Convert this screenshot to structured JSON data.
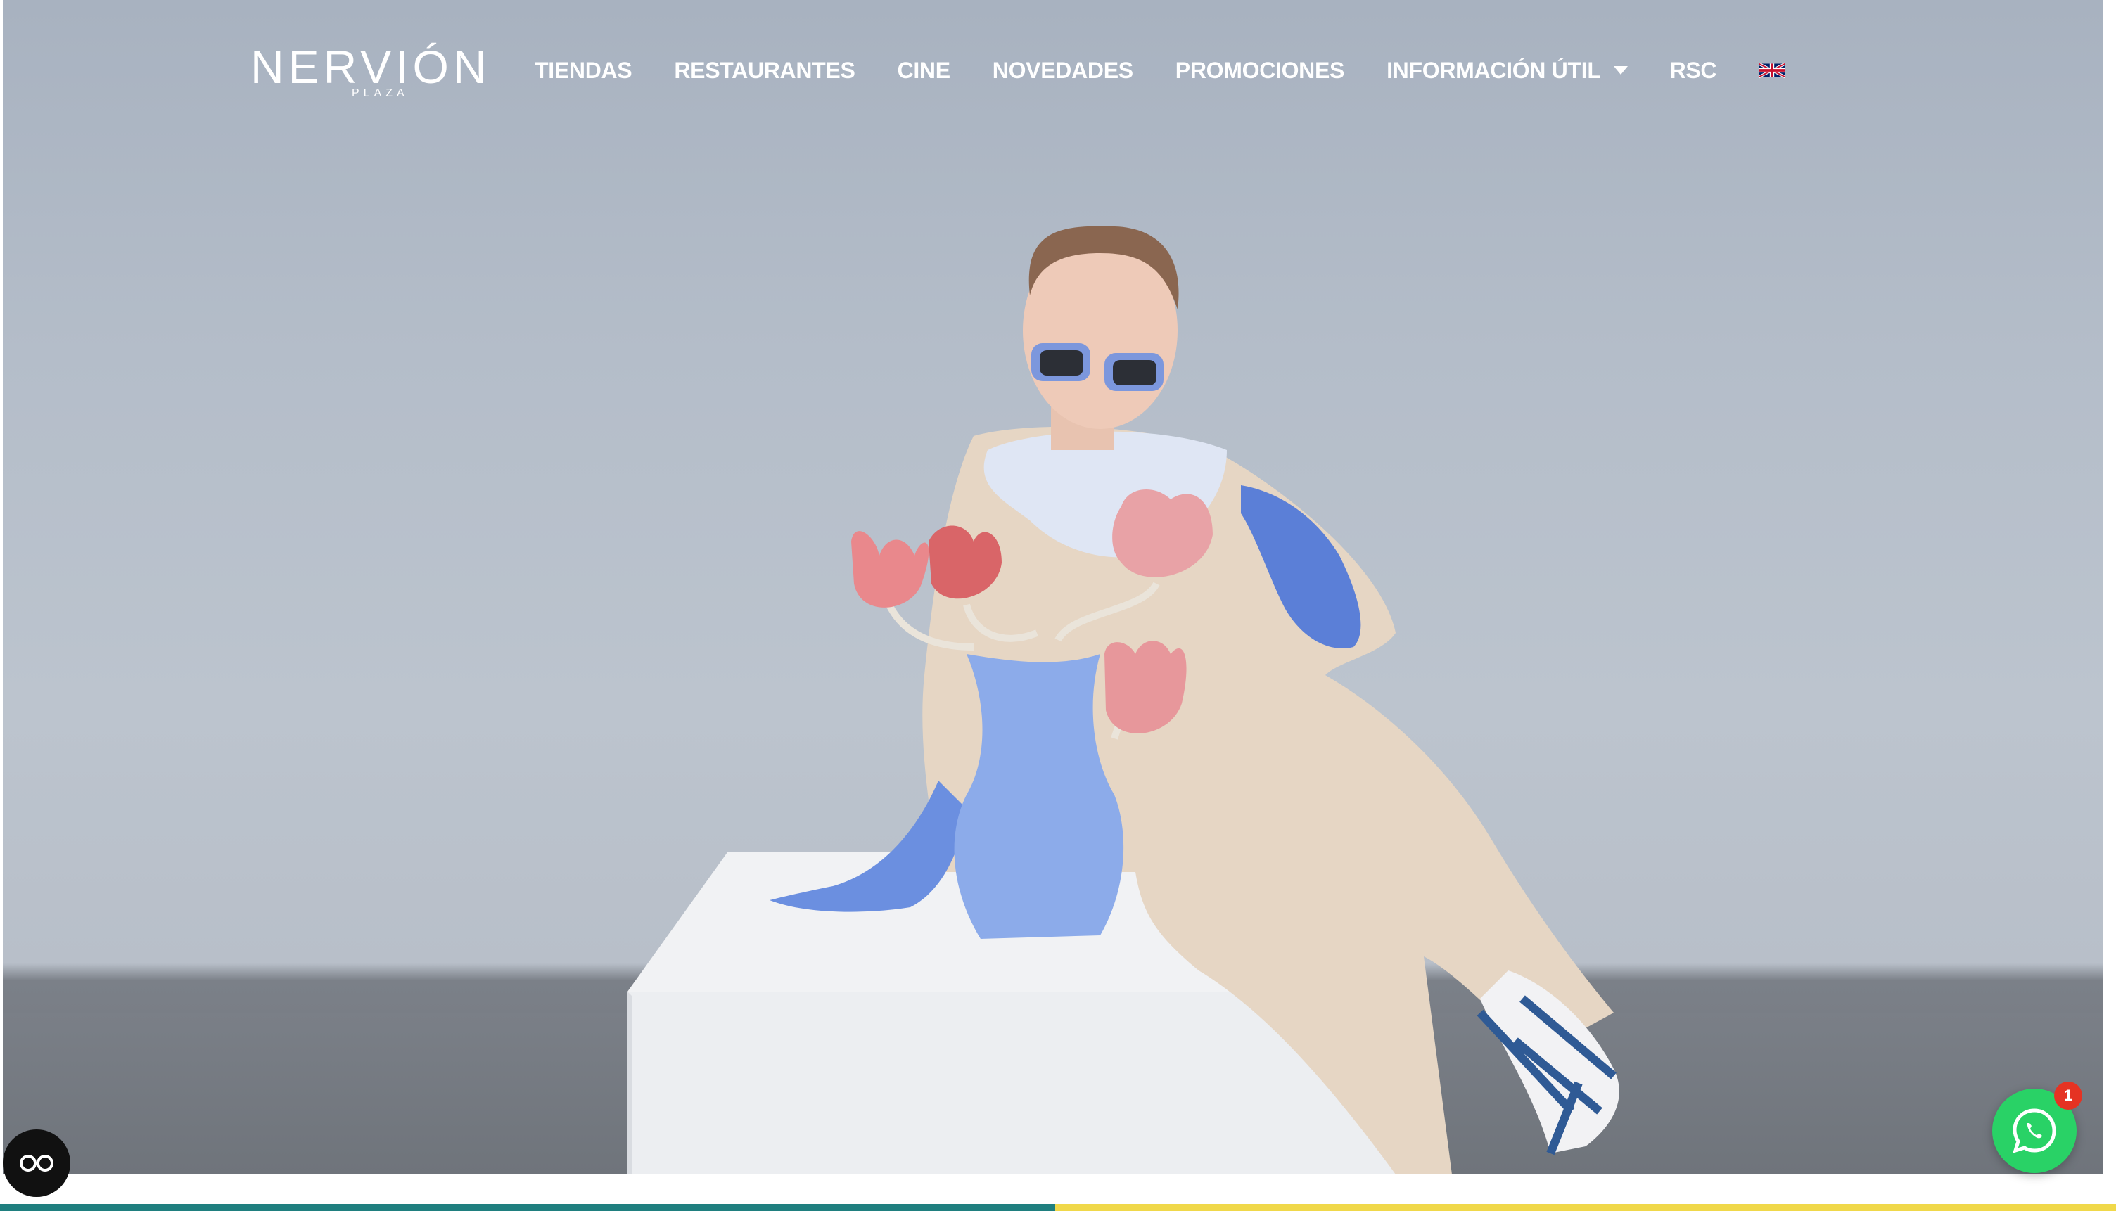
{
  "brand": {
    "name": "NERVIÓN",
    "sub": "PLAZA"
  },
  "nav": {
    "items": [
      {
        "label": "TIENDAS"
      },
      {
        "label": "RESTAURANTES"
      },
      {
        "label": "CINE"
      },
      {
        "label": "NOVEDADES"
      },
      {
        "label": "PROMOCIONES"
      },
      {
        "label": "INFORMACIÓN ÚTIL"
      },
      {
        "label": "RSC"
      }
    ],
    "language_icon": "uk-flag-icon"
  },
  "widgets": {
    "accessibility_icon": "accessibility-glasses-icon",
    "whatsapp_icon": "whatsapp-icon",
    "whatsapp_badge": "1"
  },
  "colors": {
    "bar_left": "#1f7f7f",
    "bar_right": "#f0d84a",
    "whatsapp": "#29d266",
    "badge": "#e53323"
  }
}
